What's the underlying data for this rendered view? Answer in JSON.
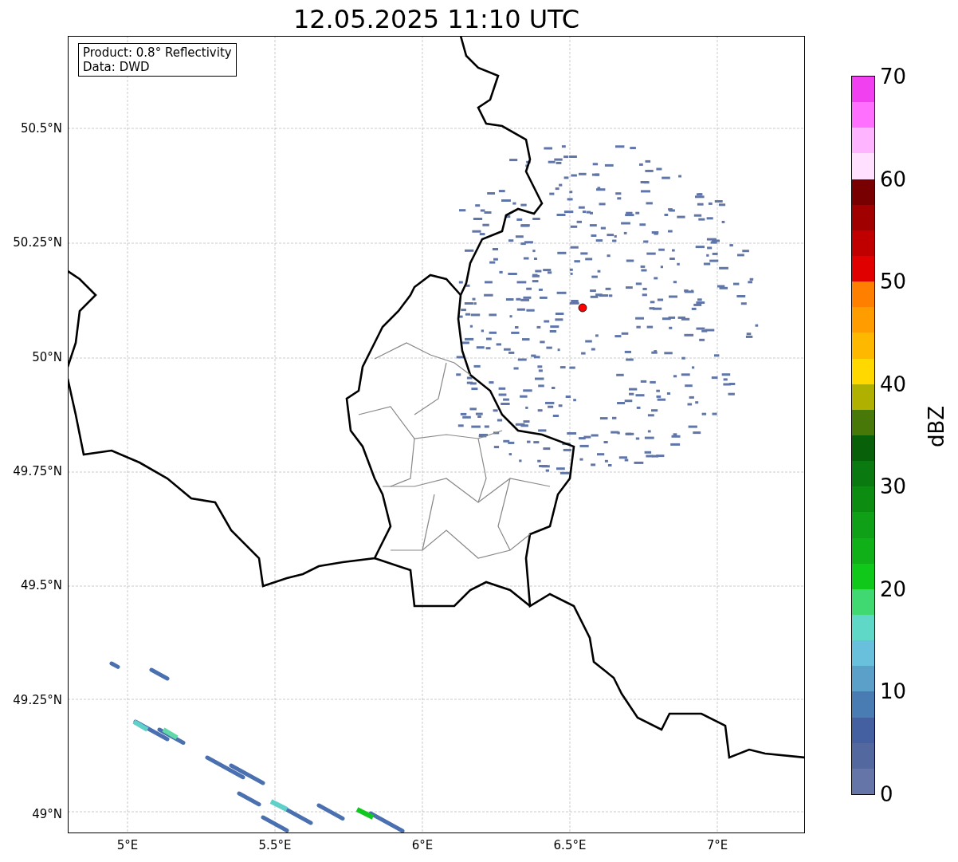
{
  "title": "12.05.2025 11:10 UTC",
  "info_box": [
    "Product: 0.8° Reflectivity",
    "Data: DWD"
  ],
  "map": {
    "x_tick_labels": [
      "5°E",
      "5.5°E",
      "6°E",
      "6.5°E",
      "7°E"
    ],
    "y_tick_labels": [
      "50.5°N",
      "50.25°N",
      "50°N",
      "49.75°N",
      "49.5°N",
      "49.25°N",
      "49°N"
    ]
  },
  "colorbar": {
    "label": "dBZ",
    "tick_labels": [
      "70",
      "60",
      "50",
      "40",
      "30",
      "20",
      "10",
      "0"
    ],
    "bands": [
      {
        "color": "#f040f0"
      },
      {
        "color": "#ff70ff"
      },
      {
        "color": "#ffb4ff"
      },
      {
        "color": "#ffe0ff"
      },
      {
        "color": "#780000"
      },
      {
        "color": "#a00000"
      },
      {
        "color": "#c00000"
      },
      {
        "color": "#e00000"
      },
      {
        "color": "#ff8000"
      },
      {
        "color": "#ff9c00"
      },
      {
        "color": "#ffb800"
      },
      {
        "color": "#ffd800"
      },
      {
        "color": "#b0b000"
      },
      {
        "color": "#487808"
      },
      {
        "color": "#086008"
      },
      {
        "color": "#0a7a10"
      },
      {
        "color": "#0c8c10"
      },
      {
        "color": "#10a018"
      },
      {
        "color": "#10b018"
      },
      {
        "color": "#10c81a"
      },
      {
        "color": "#40d870"
      },
      {
        "color": "#60d8c8"
      },
      {
        "color": "#68c0dc"
      },
      {
        "color": "#5aa0c8"
      },
      {
        "color": "#4a7cb4"
      },
      {
        "color": "#4460a0"
      },
      {
        "color": "#5468a0"
      },
      {
        "color": "#6675a8"
      }
    ]
  }
}
